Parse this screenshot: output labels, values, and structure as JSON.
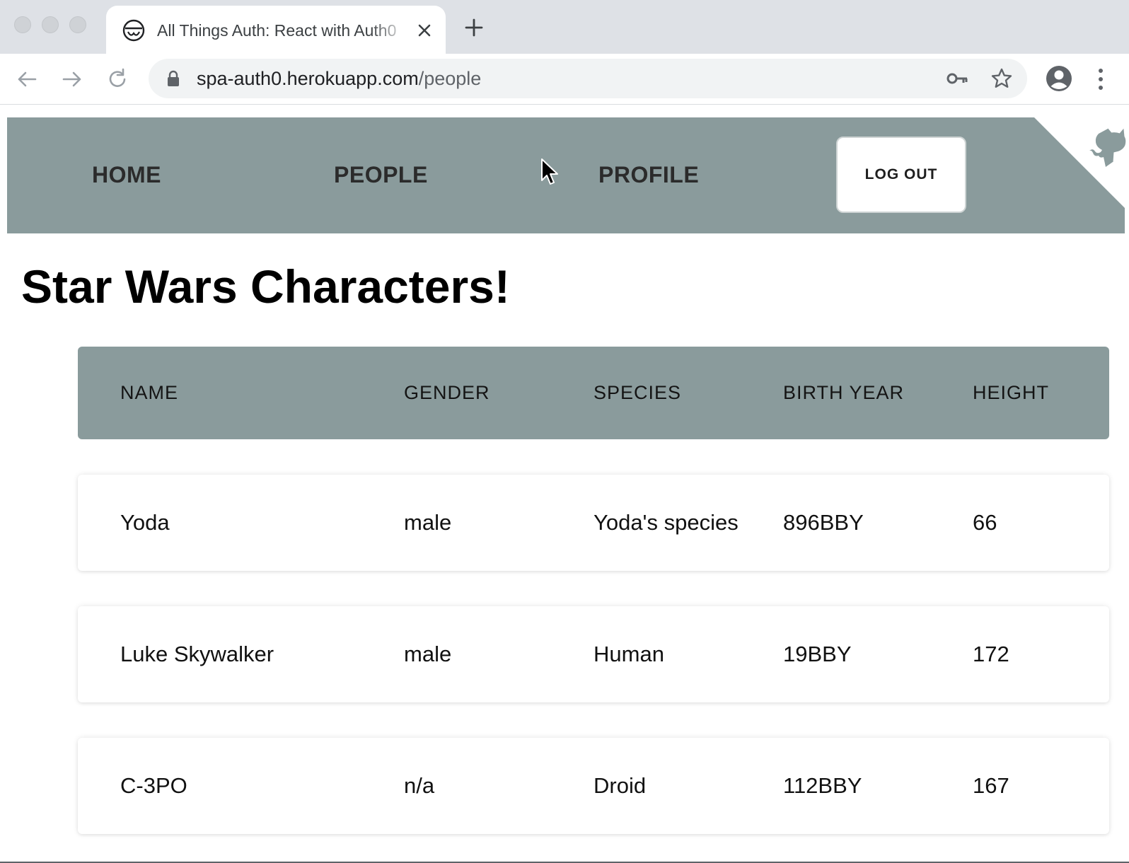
{
  "browser": {
    "tab": {
      "title": "All Things Auth: React with Auth0",
      "favicon": "spa-globe-icon"
    },
    "address": {
      "host": "spa-auth0.herokuapp.com",
      "path": "/people"
    },
    "icons": [
      "back-arrow-icon",
      "forward-arrow-icon",
      "reload-icon",
      "lock-icon",
      "key-icon",
      "star-icon",
      "profile-icon",
      "menu-icon",
      "plus-icon",
      "close-icon"
    ]
  },
  "nav": {
    "home": "HOME",
    "people": "PEOPLE",
    "profile": "PROFILE",
    "logout": "LOG OUT"
  },
  "page": {
    "title": "Star Wars Characters!"
  },
  "table": {
    "headers": [
      "NAME",
      "GENDER",
      "SPECIES",
      "BIRTH YEAR",
      "HEIGHT"
    ],
    "rows": [
      [
        "Yoda",
        "male",
        "Yoda's species",
        "896BBY",
        "66"
      ],
      [
        "Luke Skywalker",
        "male",
        "Human",
        "19BBY",
        "172"
      ],
      [
        "C-3PO",
        "n/a",
        "Droid",
        "112BBY",
        "167"
      ]
    ]
  },
  "colors": {
    "navbar": "#8a9b9c",
    "table_header": "#8a9b9c",
    "tabbar": "#dee1e6",
    "omnibox": "#f1f3f4"
  }
}
